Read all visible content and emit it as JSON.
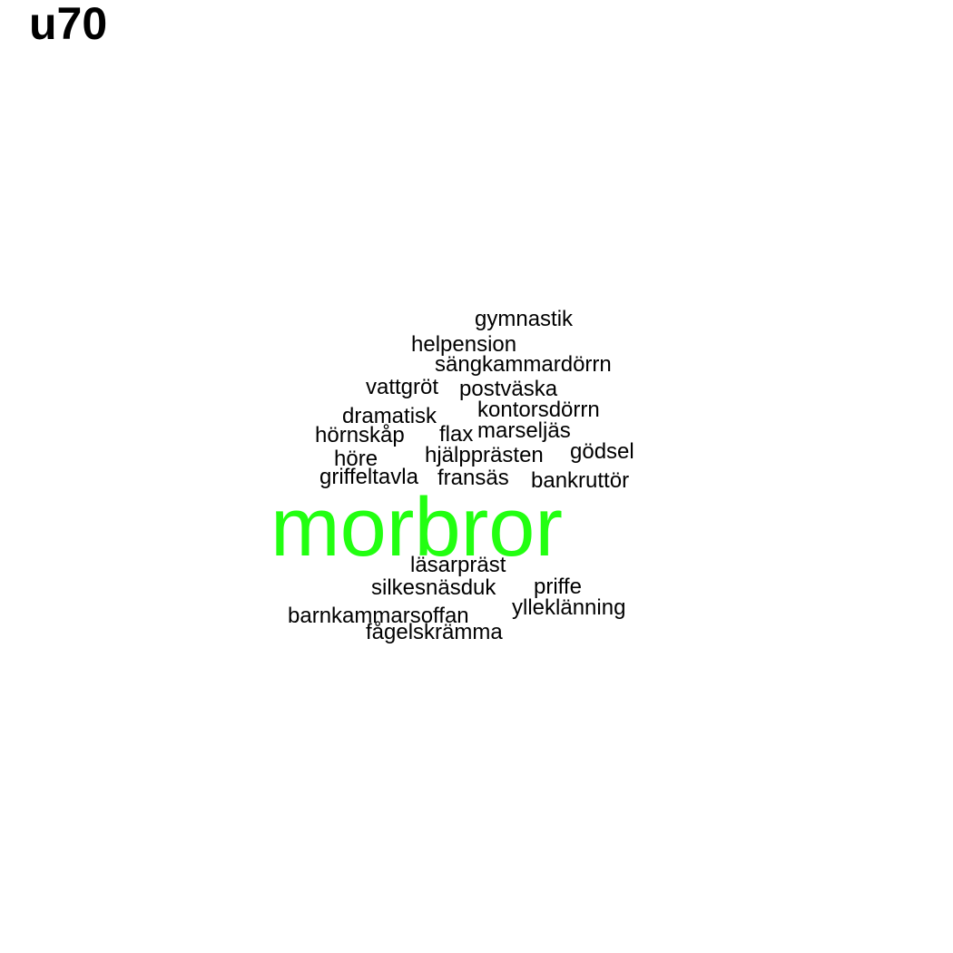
{
  "title": "u70",
  "colors": {
    "highlight": "#22ff11",
    "text": "#000000",
    "background": "#ffffff"
  },
  "words": {
    "morbror": "morbror",
    "gymnastik": "gymnastik",
    "helpension": "helpension",
    "sangkammardorrn": "sängkammardörrn",
    "vattgrot": "vattgröt",
    "postvaska": "postväska",
    "kontorsdorrn": "kontorsdörrn",
    "dramatisk": "dramatisk",
    "hornskap": "hörnskåp",
    "flax": "flax",
    "marseljas": "marseljäs",
    "godsel": "gödsel",
    "hore": "höre",
    "hjalpprasten": "hjälpprästen",
    "griffeltavla": "griffeltavla",
    "fransas": "fransäs",
    "bankruttor": "bankruttör",
    "lasarprast": "läsarpräst",
    "silkesnasduk": "silkesnäsduk",
    "priffe": "priffe",
    "ylleklanning": "ylleklänning",
    "barnkammarsoffan": "barnkammarsoffan",
    "fagelskramma": "fågelskrämma"
  }
}
